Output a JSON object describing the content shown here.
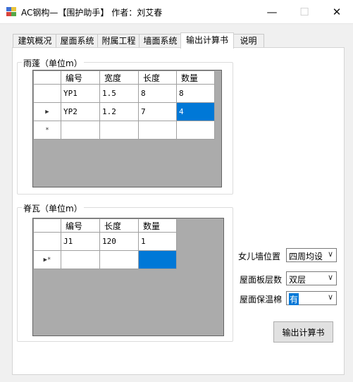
{
  "window": {
    "title": "AC钢构—【围护助手】 作者：刘艾春",
    "minimize": "—",
    "maximize": "☐",
    "close": "✕"
  },
  "tabs": [
    {
      "label": "建筑概况"
    },
    {
      "label": "屋面系统"
    },
    {
      "label": "附属工程"
    },
    {
      "label": "墙面系统"
    },
    {
      "label": "输出计算书"
    },
    {
      "label": "说明"
    }
  ],
  "canopy": {
    "title": "雨蓬（单位m）",
    "columns": [
      "编号",
      "宽度",
      "长度",
      "数量"
    ],
    "rows": [
      {
        "marker": "",
        "cells": [
          "YP1",
          "1.5",
          "8",
          "8"
        ]
      },
      {
        "marker": "▶",
        "cells": [
          "YP2",
          "1.2",
          "7",
          "4"
        ]
      },
      {
        "marker": "*",
        "cells": [
          "",
          "",
          "",
          ""
        ]
      }
    ]
  },
  "ridge": {
    "title": "脊瓦（单位m）",
    "columns": [
      "编号",
      "长度",
      "数量"
    ],
    "rows": [
      {
        "marker": "",
        "cells": [
          "J1",
          "120",
          "1"
        ]
      },
      {
        "marker": "▶*",
        "cells": [
          "",
          "",
          ""
        ]
      }
    ]
  },
  "options": {
    "parapet": {
      "label": "女儿墙位置",
      "value": "四周均设"
    },
    "layers": {
      "label": "屋面板层数",
      "value": "双层"
    },
    "insulation": {
      "label": "屋面保温棉",
      "value": "有"
    }
  },
  "output_button": "输出计算书"
}
